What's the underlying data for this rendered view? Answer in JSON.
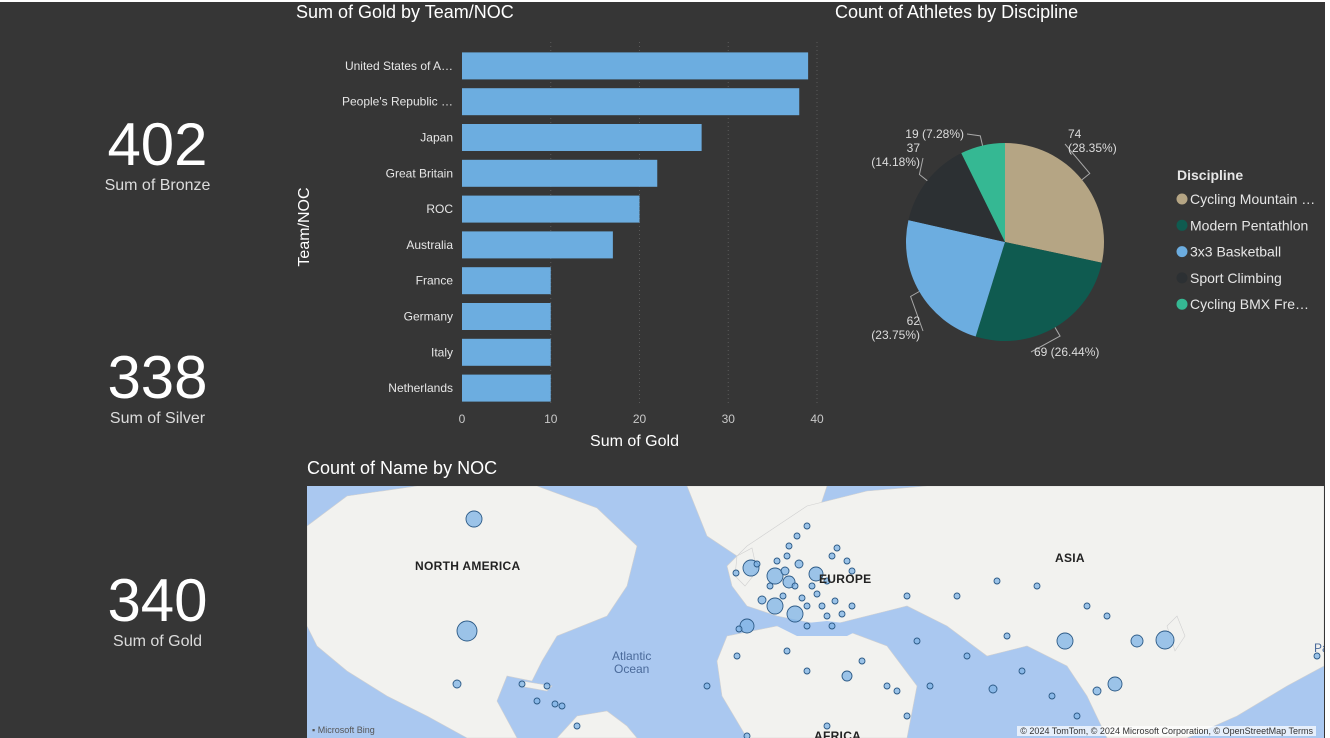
{
  "kpis": [
    {
      "value": "402",
      "label": "Sum of Bronze"
    },
    {
      "value": "338",
      "label": "Sum of Silver"
    },
    {
      "value": "340",
      "label": "Sum of Gold"
    }
  ],
  "map": {
    "title": "Count of Name by NOC",
    "labels": {
      "north_america": "NORTH AMERICA",
      "europe": "EUROPE",
      "asia": "ASIA",
      "africa": "AFRICA",
      "atlantic": "Atlantic",
      "ocean": "Ocean",
      "pacific": "Pa"
    },
    "bing": "Microsoft Bing",
    "attribution": "© 2024 TomTom, © 2024 Microsoft Corporation, © OpenStreetMap  Terms"
  },
  "colors": {
    "background": "#363636",
    "bar": "#6cade0",
    "pie": [
      "#b5a584",
      "#0f5b50",
      "#6cade0",
      "#2c3033",
      "#35b893"
    ],
    "bubble": "#7eb3e6",
    "land": "#f2f2ef",
    "water": "#aac8f0"
  },
  "chart_data": [
    {
      "type": "bar",
      "orientation": "horizontal",
      "title": "Sum of Gold by Team/NOC",
      "xlabel": "Sum of Gold",
      "ylabel": "Team/NOC",
      "categories": [
        "United States of A…",
        "People's Republic …",
        "Japan",
        "Great Britain",
        "ROC",
        "Australia",
        "France",
        "Germany",
        "Italy",
        "Netherlands"
      ],
      "values": [
        39,
        38,
        27,
        22,
        20,
        17,
        10,
        10,
        10,
        10
      ],
      "xlim": [
        0,
        40
      ],
      "xticks": [
        "0",
        "10",
        "20",
        "30",
        "40"
      ],
      "grid": true
    },
    {
      "type": "pie",
      "title": "Count of Athletes by Discipline",
      "legend_title": "Discipline",
      "legend_position": "right",
      "categories": [
        "Cycling Mountain …",
        "Modern Pentathlon",
        "3x3 Basketball",
        "Sport Climbing",
        "Cycling BMX Fre…"
      ],
      "values": [
        74,
        69,
        62,
        37,
        19
      ],
      "percents": [
        "28.35%",
        "26.44%",
        "23.75%",
        "14.18%",
        "7.28%"
      ]
    }
  ]
}
